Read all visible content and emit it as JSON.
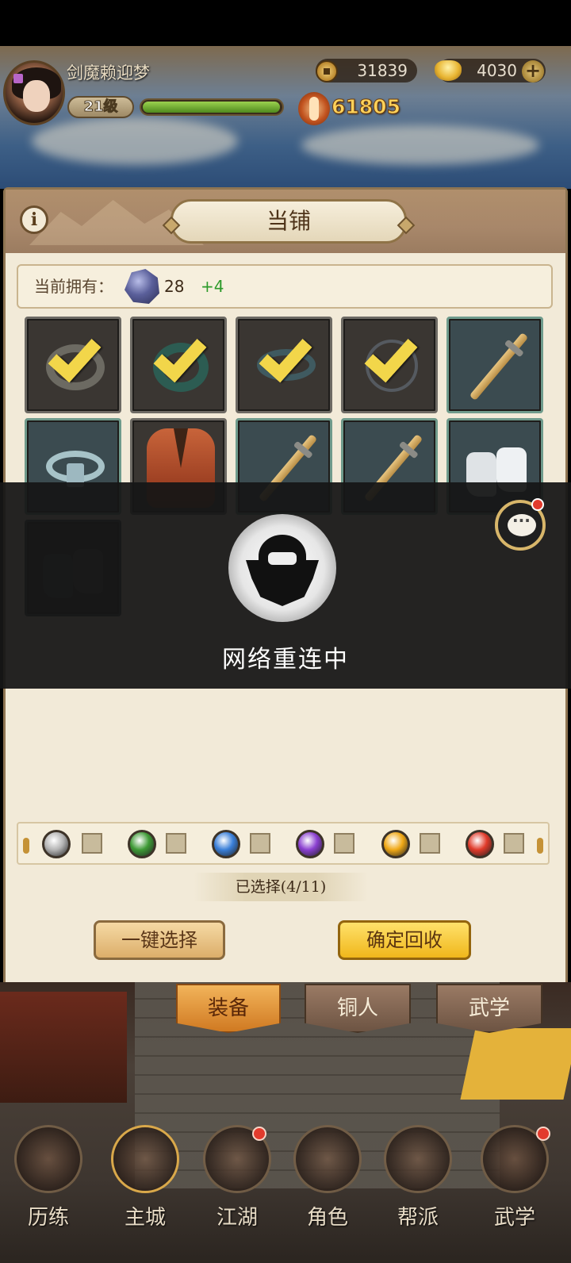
{
  "player": {
    "name": "剑魔赖迎梦",
    "level": "21级",
    "exp_progress": 0.97,
    "power": "61805",
    "coins": "31839",
    "gold": "4030"
  },
  "panel": {
    "title": "当铺",
    "owned_label": "当前拥有：",
    "owned_count": "28",
    "owned_bonus": "+4"
  },
  "items": [
    {
      "type": "ring",
      "selected": true
    },
    {
      "type": "jade-pendant",
      "selected": true
    },
    {
      "type": "belt",
      "selected": true
    },
    {
      "type": "cord-ring",
      "selected": true
    },
    {
      "type": "sword",
      "selected": false
    },
    {
      "type": "sash",
      "selected": false
    },
    {
      "type": "vest",
      "selected": false
    },
    {
      "type": "sword",
      "selected": false
    },
    {
      "type": "sword",
      "selected": false
    },
    {
      "type": "white-boots",
      "selected": false
    },
    {
      "type": "dark-boots",
      "selected": false
    }
  ],
  "overlay": {
    "message": "网络重连中"
  },
  "quality_filters": [
    {
      "color": "#b4b4b4"
    },
    {
      "color": "#3e9a36"
    },
    {
      "color": "#3a7fd8"
    },
    {
      "color": "#8a3fd0"
    },
    {
      "color": "#f0a816"
    },
    {
      "color": "#e03a2a"
    }
  ],
  "selection": {
    "text": "已选择(4/11)"
  },
  "buttons": {
    "select_all": "一键选择",
    "confirm_recycle": "确定回收"
  },
  "tabs": {
    "equipment": "装备",
    "bronze_man": "铜人",
    "martial": "武学"
  },
  "nav": {
    "training": "历练",
    "main_city": "主城",
    "jianghu": "江湖",
    "character": "角色",
    "guild": "帮派",
    "martial": "武学"
  }
}
